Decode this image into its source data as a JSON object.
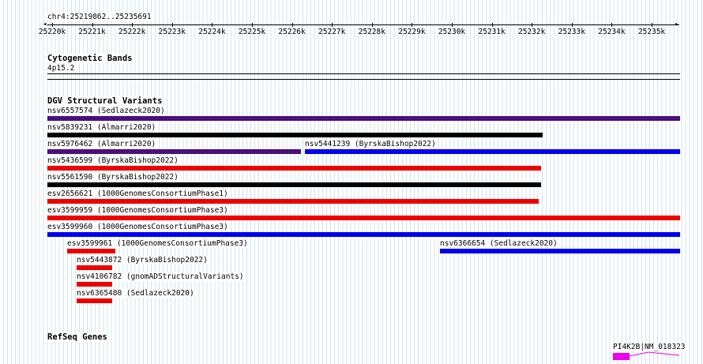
{
  "position": "chr4:25219862..25235691",
  "ruler": {
    "ticks": [
      "25220k",
      "25221k",
      "25222k",
      "25223k",
      "25224k",
      "25225k",
      "25226k",
      "25227k",
      "25228k",
      "25229k",
      "25230k",
      "25231k",
      "25232k",
      "25233k",
      "25234k",
      "25235k"
    ]
  },
  "tracks": {
    "cytobands": {
      "title": "Cytogenetic Bands",
      "band": "4p15.2"
    },
    "dgv": {
      "title": "DGV Structural Variants",
      "features": [
        {
          "id": "nsv6557574",
          "label": "nsv6557574 (Sedlazeck2020)",
          "color": "#4b0e7d"
        },
        {
          "id": "nsv5839231",
          "label": "nsv5839231 (Almarri2020)",
          "color": "#000000"
        },
        {
          "id": "nsv5976462",
          "label": "nsv5976462 (Almarri2020)",
          "color": "#4b0e7d"
        },
        {
          "id": "nsv5441239",
          "label": "nsv5441239 (ByrskaBishop2022)",
          "color": "#0000ee"
        },
        {
          "id": "nsv5436599",
          "label": "nsv5436599 (ByrskaBishop2022)",
          "color": "#ee0000"
        },
        {
          "id": "nsv5561590",
          "label": "nsv5561590 (ByrskaBishop2022)",
          "color": "#000000"
        },
        {
          "id": "esv2656621",
          "label": "esv2656621 (1000GenomesConsortiumPhase1)",
          "color": "#ee0000"
        },
        {
          "id": "esv3599959",
          "label": "esv3599959 (1000GenomesConsortiumPhase3)",
          "color": "#ee0000"
        },
        {
          "id": "esv3599960",
          "label": "esv3599960 (1000GenomesConsortiumPhase3)",
          "color": "#0000ee"
        },
        {
          "id": "esv3599961",
          "label": "esv3599961 (1000GenomesConsortiumPhase3)",
          "color": "#ee0000"
        },
        {
          "id": "nsv6366654",
          "label": "nsv6366654 (Sedlazeck2020)",
          "color": "#0000ee"
        },
        {
          "id": "nsv5443872",
          "label": "nsv5443872 (ByrskaBishop2022)",
          "color": "#ee0000"
        },
        {
          "id": "nsv4106782",
          "label": "nsv4106782 (gnomADStructuralVariants)",
          "color": "#ee0000"
        },
        {
          "id": "nsv6365480",
          "label": "nsv6365480 (Sedlazeck2020)",
          "color": "#ee0000"
        }
      ]
    },
    "refseq": {
      "title": "RefSeq Genes",
      "gene": {
        "label": "PI4K2B|NM_018323",
        "color": "#ee00ee"
      }
    }
  }
}
